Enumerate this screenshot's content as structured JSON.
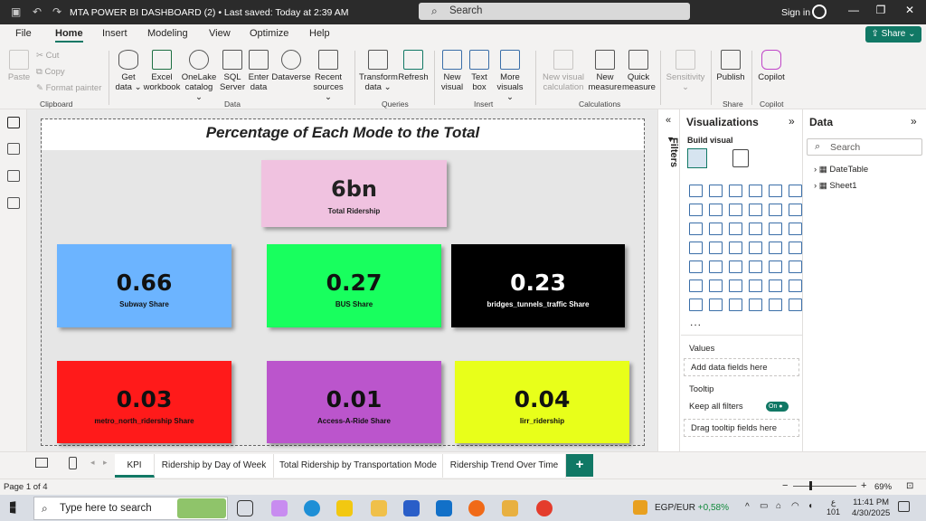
{
  "title_bar": {
    "app_title": "MTA POWER BI DASHBOARD (2) • Last saved: Today at 2:39 AM",
    "search_placeholder": "Search",
    "sign_in": "Sign in",
    "share_label": "Share"
  },
  "menu": [
    "File",
    "Home",
    "Insert",
    "Modeling",
    "View",
    "Optimize",
    "Help"
  ],
  "active_menu": "Home",
  "ribbon": {
    "clipboard": {
      "paste": "Paste",
      "cut": "Cut",
      "copy": "Copy",
      "format_painter": "Format painter",
      "group": "Clipboard"
    },
    "data": {
      "buttons": [
        {
          "l1": "Get",
          "l2": "data ⌄"
        },
        {
          "l1": "Excel",
          "l2": "workbook"
        },
        {
          "l1": "OneLake",
          "l2": "catalog ⌄"
        },
        {
          "l1": "SQL",
          "l2": "Server"
        },
        {
          "l1": "Enter",
          "l2": "data"
        },
        {
          "l1": "Dataverse",
          "l2": ""
        },
        {
          "l1": "Recent",
          "l2": "sources ⌄"
        }
      ],
      "group": "Data"
    },
    "queries": {
      "buttons": [
        {
          "l1": "Transform",
          "l2": "data ⌄"
        },
        {
          "l1": "Refresh",
          "l2": ""
        }
      ],
      "group": "Queries"
    },
    "insert": {
      "buttons": [
        {
          "l1": "New",
          "l2": "visual"
        },
        {
          "l1": "Text",
          "l2": "box"
        },
        {
          "l1": "More",
          "l2": "visuals ⌄"
        }
      ],
      "group": "Insert"
    },
    "calculations": {
      "buttons": [
        {
          "l1": "New visual",
          "l2": "calculation"
        },
        {
          "l1": "New",
          "l2": "measure"
        },
        {
          "l1": "Quick",
          "l2": "measure"
        }
      ],
      "group": "Calculations"
    },
    "sensitivity": {
      "l1": "Sensitivity",
      "l2": "⌄"
    },
    "share": {
      "l1": "Publish",
      "group": "Share"
    },
    "copilot": {
      "l1": "Copilot",
      "group": "Copilot"
    }
  },
  "report": {
    "title": "Percentage of Each Mode to the Total",
    "cards": [
      {
        "value": "6bn",
        "label": "Total Ridership",
        "bg": "#f0c2e0",
        "fg": "#222222"
      },
      {
        "value": "0.66",
        "label": "Subway Share",
        "bg": "#6cb4ff",
        "fg": "#111111"
      },
      {
        "value": "0.27",
        "label": "BUS Share",
        "bg": "#18ff5e",
        "fg": "#111111"
      },
      {
        "value": "0.23",
        "label": "bridges_tunnels_traffic Share",
        "bg": "#000000",
        "fg": "#ffffff"
      },
      {
        "value": "0.03",
        "label": "metro_north_ridership Share",
        "bg": "#ff1a1a",
        "fg": "#111111"
      },
      {
        "value": "0.01",
        "label": "Access-A-Ride Share",
        "bg": "#bb55cc",
        "fg": "#111111"
      },
      {
        "value": "0.04",
        "label": "lirr_ridership",
        "bg": "#e8ff1a",
        "fg": "#111111"
      }
    ]
  },
  "filters_label": "Filters",
  "visualizations": {
    "title": "Visualizations",
    "build_visual": "Build visual",
    "values_label": "Values",
    "values_drop": "Add data fields here",
    "tooltip_label": "Tooltip",
    "keep_filters": "Keep all filters",
    "toggle": "On",
    "tooltip_drop": "Drag tooltip fields here",
    "more": "..."
  },
  "data_pane": {
    "title": "Data",
    "search_placeholder": "Search",
    "tables": [
      "DateTable",
      "Sheet1"
    ]
  },
  "tabs": [
    "KPI",
    "Ridership by Day of Week",
    "Total Ridership by Transportation Mode",
    "Ridership Trend Over Time"
  ],
  "active_tab": "KPI",
  "status": {
    "page": "Page 1 of 4",
    "zoom": "69%"
  },
  "taskbar": {
    "search_placeholder": "Type here to search",
    "ticker_pair": "EGP/EUR",
    "ticker_change": "+0,58%",
    "time": "11:41 PM",
    "date": "4/30/2025",
    "lang": "ع",
    "badge": "101"
  }
}
